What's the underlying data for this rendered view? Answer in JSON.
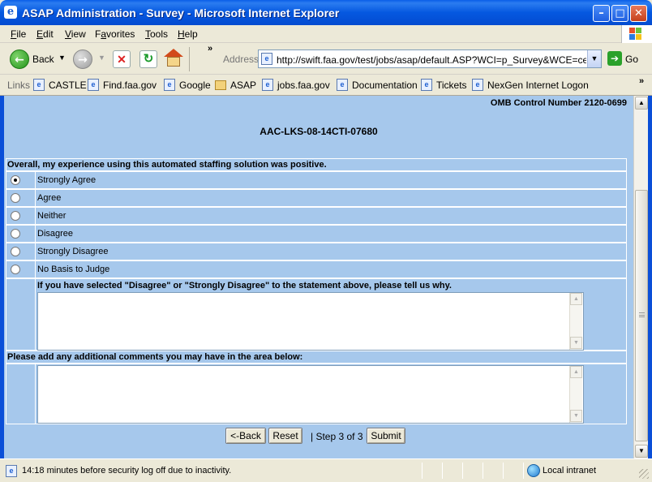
{
  "window": {
    "title": "ASAP Administration - Survey - Microsoft Internet Explorer",
    "minimize": "–",
    "maximize": "□",
    "close": "✕"
  },
  "menu": [
    "File",
    "Edit",
    "View",
    "Favorites",
    "Tools",
    "Help"
  ],
  "menu_underline": [
    "F",
    "E",
    "V",
    "a",
    "T",
    "H"
  ],
  "toolbar": {
    "back_label": "Back",
    "address_label": "Address",
    "url": "http://swift.faa.gov/test/jobs/asap/default.ASP?WCI=p_Survey&WCE=ceSave",
    "go_label": "Go",
    "chevron": "»"
  },
  "links": {
    "label": "Links",
    "items": [
      "CASTLE",
      "Find.faa.gov",
      "Google",
      "ASAP",
      "jobs.faa.gov",
      "Documentation",
      "Tickets",
      "NexGen Internet Logon"
    ],
    "chevron": "»"
  },
  "page": {
    "omb": "OMB Control Number 2120-0699",
    "job_id": "AAC-LKS-08-14CTI-07680",
    "question": "Overall, my experience using this automated staffing solution was positive.",
    "options": [
      "Strongly Agree",
      "Agree",
      "Neither",
      "Disagree",
      "Strongly Disagree",
      "No Basis to Judge"
    ],
    "selected_option": "Strongly Agree",
    "disagree_prompt": "If you have selected \"Disagree\" or \"Strongly Disagree\" to the statement above, please tell us why.",
    "disagree_value": "",
    "comments_prompt": "Please add any additional comments you may have in the area below:",
    "comments_value": "",
    "buttons": {
      "back": "<-Back",
      "reset": "Reset",
      "step": "| Step 3 of 3 |",
      "submit": "Submit"
    }
  },
  "status": {
    "text": "14:18 minutes before security log off due to inactivity.",
    "zone": "Local intranet"
  }
}
